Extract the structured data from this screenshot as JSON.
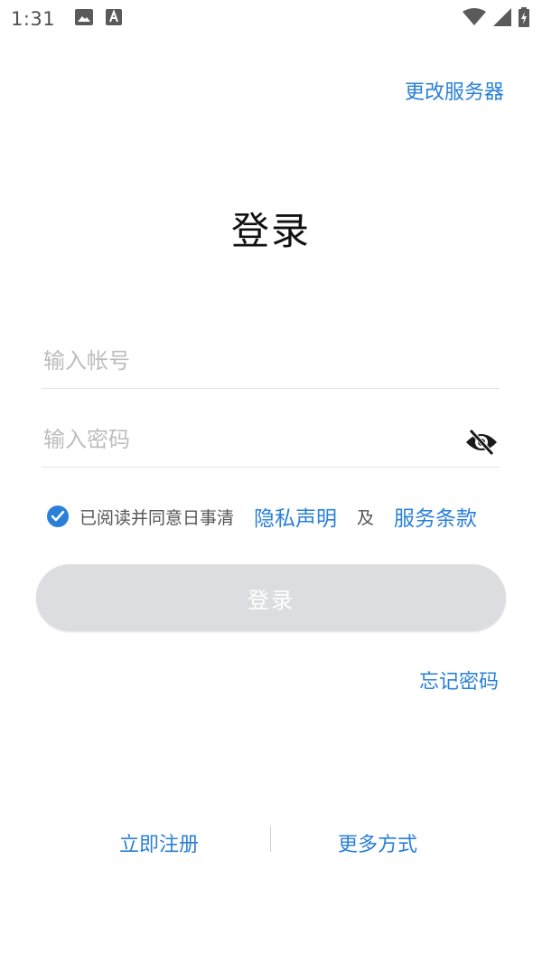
{
  "status_bar": {
    "time": "1:31",
    "icons": [
      "image-icon",
      "text-a-icon",
      "wifi-icon",
      "signal-icon",
      "battery-charging-icon"
    ]
  },
  "header": {
    "change_server": "更改服务器"
  },
  "title": "登录",
  "form": {
    "account_placeholder": "输入帐号",
    "password_placeholder": "输入密码",
    "account_value": "",
    "password_value": ""
  },
  "agreement": {
    "checked": true,
    "prefix": "已阅读并同意日事清",
    "privacy": "隐私声明",
    "and": "及",
    "terms": "服务条款"
  },
  "login_button": "登录",
  "forgot_password": "忘记密码",
  "footer": {
    "register": "立即注册",
    "more": "更多方式"
  },
  "colors": {
    "accent": "#2a80d8",
    "button_disabled": "#dcdde0",
    "placeholder": "#bdbdbd",
    "divider": "#e3e3e3"
  }
}
